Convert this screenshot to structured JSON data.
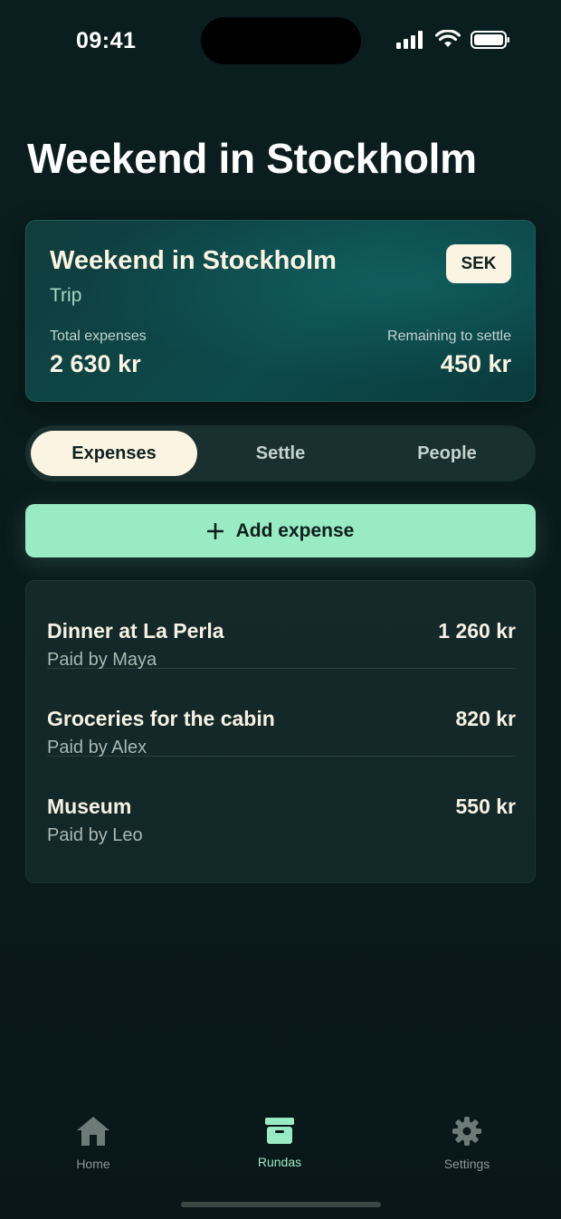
{
  "status_bar": {
    "time": "09:41",
    "icons": [
      "cellular-signal-icon",
      "wifi-icon",
      "battery-icon"
    ]
  },
  "page": {
    "title": "Weekend in Stockholm"
  },
  "summary": {
    "title": "Weekend in Stockholm",
    "type": "Trip",
    "currency": "SEK",
    "total_label": "Total expenses",
    "total_value": "2 630 kr",
    "remaining_label": "Remaining to settle",
    "remaining_value": "450 kr"
  },
  "tabs": [
    {
      "label": "Expenses",
      "active": true
    },
    {
      "label": "Settle",
      "active": false
    },
    {
      "label": "People",
      "active": false
    }
  ],
  "add_button": {
    "icon": "plus-icon",
    "label": "Add expense"
  },
  "expenses": [
    {
      "title": "Dinner at La Perla",
      "paid_by": "Paid by Maya",
      "amount": "1 260 kr"
    },
    {
      "title": "Groceries for the cabin",
      "paid_by": "Paid by Alex",
      "amount": "820 kr"
    },
    {
      "title": "Museum",
      "paid_by": "Paid by Leo",
      "amount": "550 kr"
    }
  ],
  "bottom_nav": [
    {
      "label": "Home",
      "icon": "house-icon",
      "active": false
    },
    {
      "label": "Rundas",
      "icon": "archive-box-icon",
      "active": true
    },
    {
      "label": "Settings",
      "icon": "gear-icon",
      "active": false
    }
  ],
  "colors": {
    "background": "#0b1e1f",
    "accent": "#98ebc3",
    "cream": "#fbf4e2",
    "card": "#0d4a4b"
  }
}
